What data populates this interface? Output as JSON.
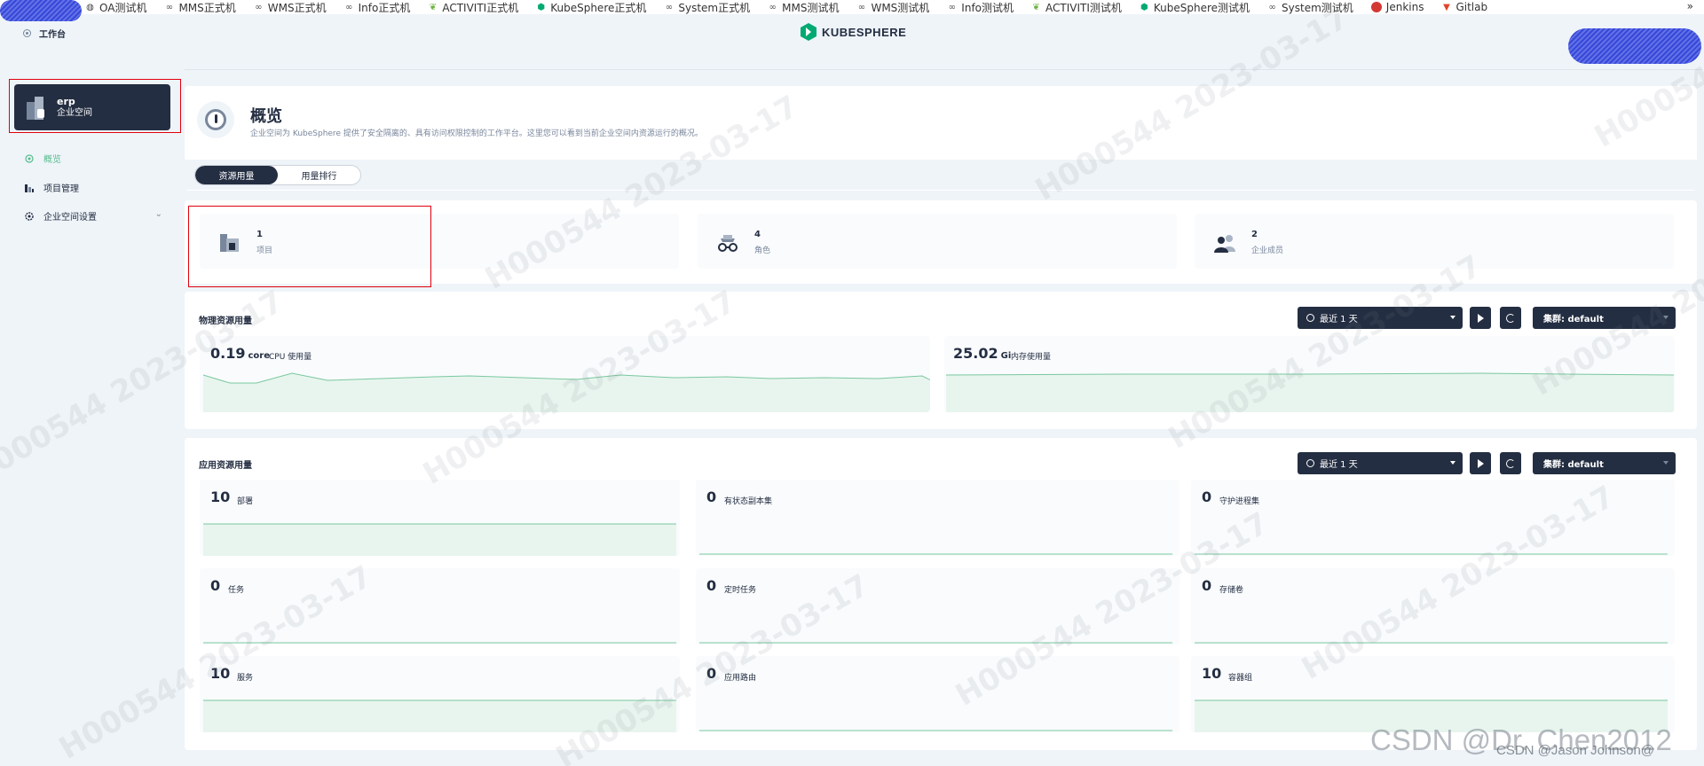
{
  "bookmarks": [
    {
      "label": "OA测试机",
      "icon": "globe-icon"
    },
    {
      "label": "MMS正式机",
      "icon": "link-icon"
    },
    {
      "label": "WMS正式机",
      "icon": "link-icon"
    },
    {
      "label": "Info正式机",
      "icon": "link-icon"
    },
    {
      "label": "ACTIVITI正式机",
      "icon": "leaf-icon"
    },
    {
      "label": "KubeSphere正式机",
      "icon": "kubesphere-icon"
    },
    {
      "label": "System正式机",
      "icon": "link-icon"
    },
    {
      "label": "MMS测试机",
      "icon": "link-icon"
    },
    {
      "label": "WMS测试机",
      "icon": "link-icon"
    },
    {
      "label": "Info测试机",
      "icon": "link-icon"
    },
    {
      "label": "ACTIVITI测试机",
      "icon": "leaf-icon"
    },
    {
      "label": "KubeSphere测试机",
      "icon": "kubesphere-icon"
    },
    {
      "label": "System测试机",
      "icon": "link-icon"
    },
    {
      "label": "Jenkins",
      "icon": "jenkins-icon"
    },
    {
      "label": "Gitlab",
      "icon": "gitlab-icon"
    }
  ],
  "bookmarks_more": "»",
  "header": {
    "workbench": "工作台",
    "logo": "KUBESPHERE"
  },
  "workspace": {
    "name": "erp",
    "type": "企业空间"
  },
  "nav": [
    {
      "label": "概览",
      "active": true,
      "icon": "dashboard-icon"
    },
    {
      "label": "项目管理",
      "active": false,
      "icon": "project-icon"
    },
    {
      "label": "企业空间设置",
      "active": false,
      "icon": "settings-icon",
      "expandable": true
    }
  ],
  "overview": {
    "title": "概览",
    "description": "企业空间为 KubeSphere 提供了安全隔离的、具有访问权限控制的工作平台。这里您可以看到当前企业空间内资源运行的概况。",
    "tabs": [
      {
        "label": "资源用量",
        "active": true
      },
      {
        "label": "用量排行",
        "active": false
      }
    ]
  },
  "stats": [
    {
      "value": "1",
      "label": "项目",
      "icon": "project-icon"
    },
    {
      "value": "4",
      "label": "角色",
      "icon": "role-icon"
    },
    {
      "value": "2",
      "label": "企业成员",
      "icon": "members-icon"
    }
  ],
  "physical": {
    "title": "物理资源用量",
    "time_range": "最近 1 天",
    "cluster": "集群: default",
    "cpu": {
      "value": "0.19",
      "unit": "core",
      "label": "CPU 使用量"
    },
    "memory": {
      "value": "25.02",
      "unit": "Gi",
      "label": "内存使用量"
    }
  },
  "application": {
    "title": "应用资源用量",
    "time_range": "最近 1 天",
    "cluster": "集群: default",
    "items": [
      {
        "value": "10",
        "label": "部署"
      },
      {
        "value": "0",
        "label": "有状态副本集"
      },
      {
        "value": "0",
        "label": "守护进程集"
      },
      {
        "value": "0",
        "label": "任务"
      },
      {
        "value": "0",
        "label": "定时任务"
      },
      {
        "value": "0",
        "label": "存储卷"
      },
      {
        "value": "10",
        "label": "服务"
      },
      {
        "value": "0",
        "label": "应用路由"
      },
      {
        "value": "10",
        "label": "容器组"
      }
    ]
  },
  "watermark": "H000544 2023-03-17",
  "csdn": {
    "main": "CSDN @Dr. Chen2012",
    "sub": "CSDN @Jason Johnson@"
  },
  "colors": {
    "dark": "#242e42",
    "accent": "#55bc8a",
    "red_box": "#e0000c"
  }
}
